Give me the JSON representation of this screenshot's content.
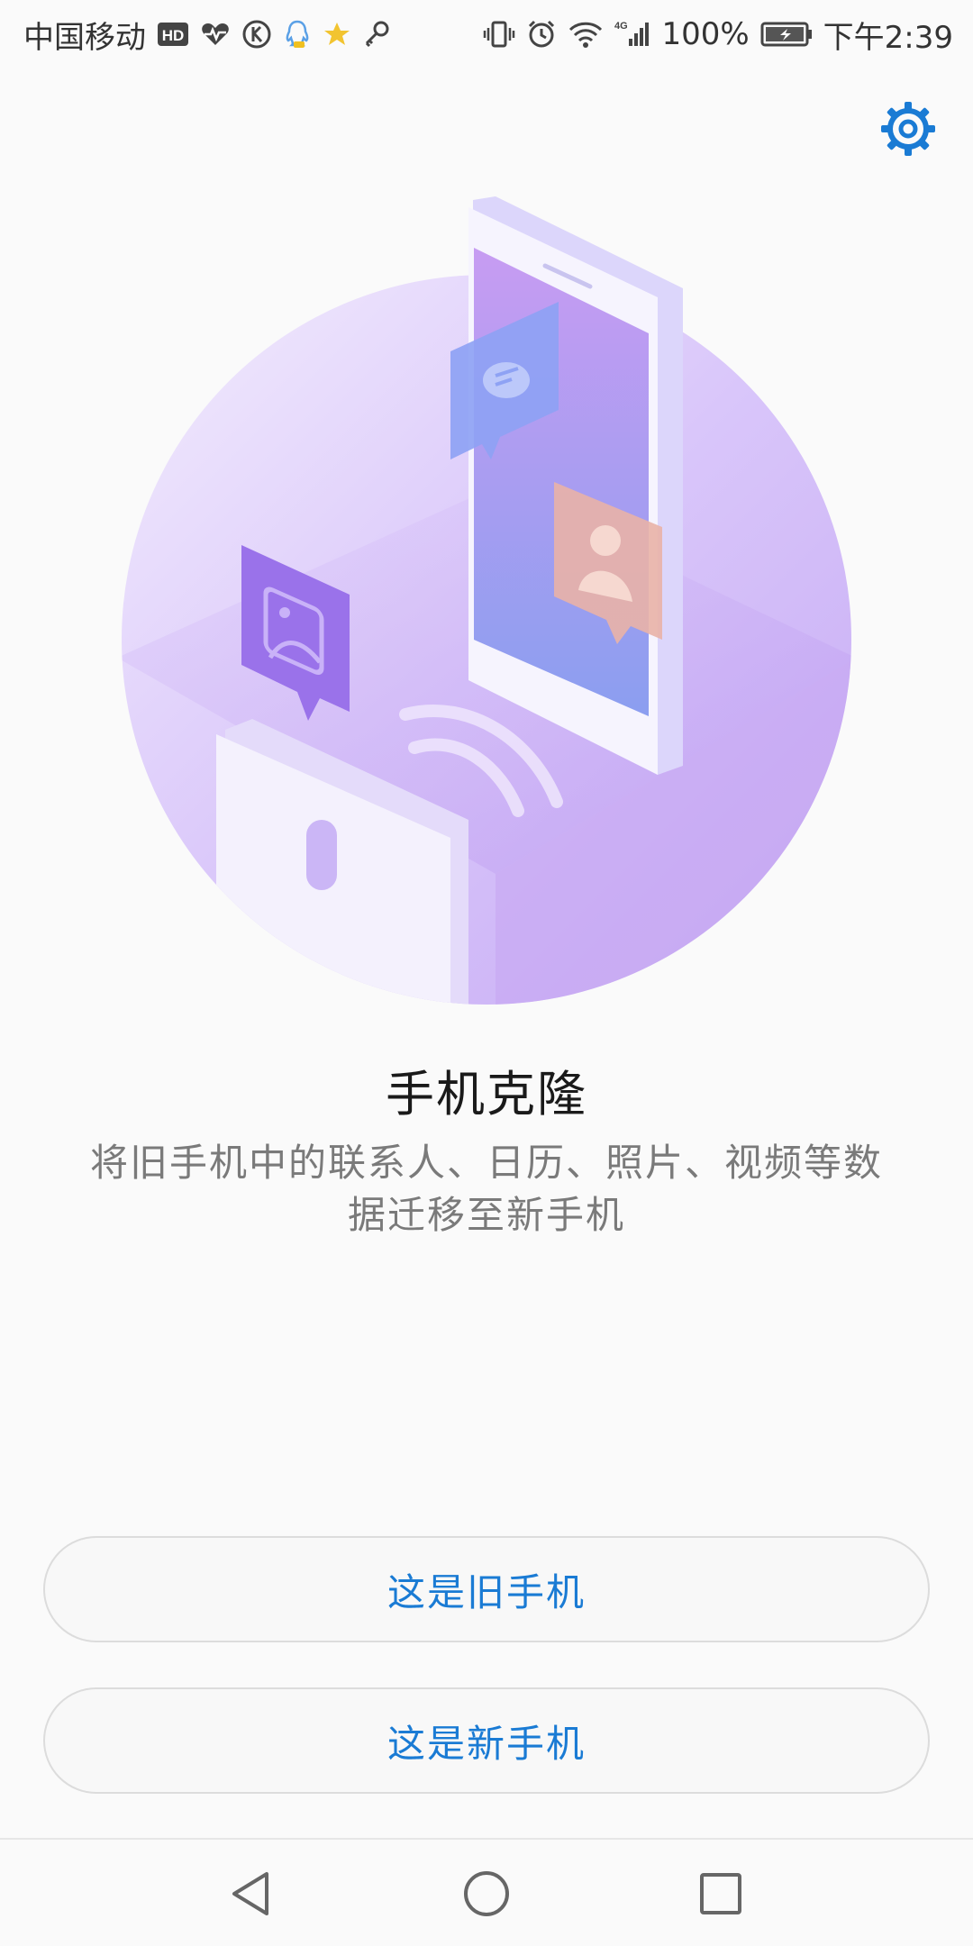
{
  "status_bar": {
    "carrier": "中国移动",
    "hd_badge": "HD",
    "network_label": "4G",
    "battery_percent": "100%",
    "time": "下午2:39",
    "icons_left": [
      "hd-icon",
      "heart-rate-icon",
      "k-icon",
      "qq-icon",
      "star-icon",
      "key-icon"
    ],
    "icons_right": [
      "vibrate-icon",
      "alarm-icon",
      "wifi-icon",
      "signal-icon",
      "battery-icon"
    ]
  },
  "header": {
    "settings_icon": "gear-icon",
    "accent_color": "#1a7bd4"
  },
  "illustration": {
    "description_icons": [
      "chat-bubble-icon",
      "contact-card-icon",
      "photo-card-icon",
      "wireless-icon"
    ]
  },
  "main": {
    "title": "手机克隆",
    "subtitle": "将旧手机中的联系人、日历、照片、视频等数据迁移至新手机"
  },
  "actions": {
    "old_phone_label": "这是旧手机",
    "new_phone_label": "这是新手机"
  },
  "nav": {
    "back_icon": "back-triangle-icon",
    "home_icon": "home-circle-icon",
    "recents_icon": "recents-square-icon"
  }
}
